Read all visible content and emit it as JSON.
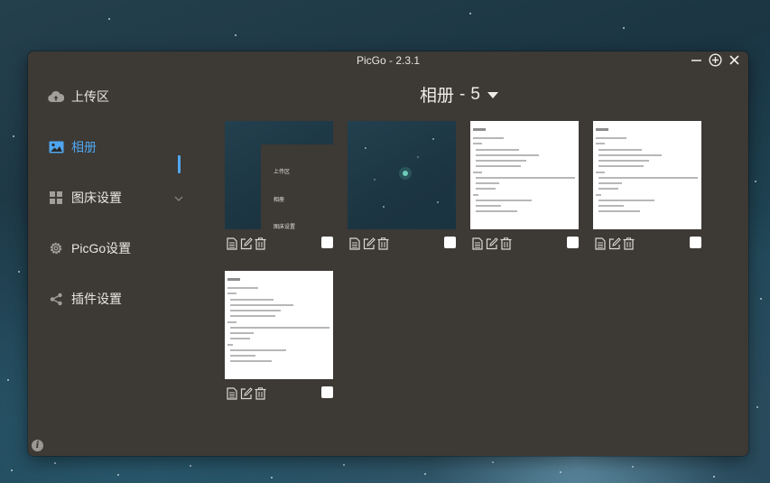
{
  "window": {
    "title": "PicGo - 2.3.1"
  },
  "sidebar": {
    "items": [
      {
        "label": "上传区",
        "icon": "cloud-upload-icon",
        "active": false
      },
      {
        "label": "相册",
        "icon": "image-icon",
        "active": true
      },
      {
        "label": "图床设置",
        "icon": "grid-icon",
        "active": false,
        "has_submenu": true
      },
      {
        "label": "PicGo设置",
        "icon": "gear-icon",
        "active": false
      },
      {
        "label": "插件设置",
        "icon": "share-icon",
        "active": false
      }
    ]
  },
  "gallery": {
    "title": "相册",
    "count": "5",
    "separator": "-",
    "images": [
      {
        "kind": "screenshot-dark",
        "checked": false,
        "preview_labels": [
          "上传区",
          "相册",
          "图床设置"
        ]
      },
      {
        "kind": "night-sky",
        "checked": false
      },
      {
        "kind": "document",
        "checked": false
      },
      {
        "kind": "document",
        "checked": false
      },
      {
        "kind": "document",
        "checked": false
      }
    ],
    "item_actions": [
      "copy-link-icon",
      "edit-icon",
      "delete-icon"
    ]
  },
  "colors": {
    "accent": "#4fa6f0",
    "window_bg": "#3d3935",
    "text": "#e9e7e4"
  }
}
